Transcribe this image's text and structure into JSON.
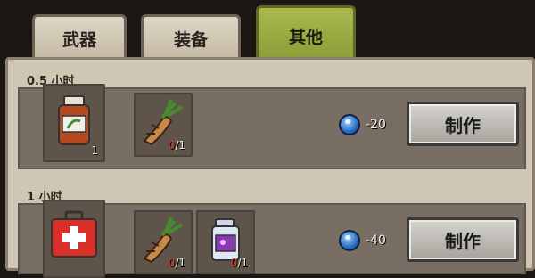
{
  "tabs": [
    {
      "label": "武器",
      "active": false
    },
    {
      "label": "装备",
      "active": false
    },
    {
      "label": "其他",
      "active": true
    }
  ],
  "recipes": [
    {
      "time": "0.5 小时",
      "result": {
        "icon": "medicine-bottle-icon",
        "count": "1"
      },
      "ingredients": [
        {
          "icon": "ginseng-root-icon",
          "have": "0",
          "need": "/1"
        }
      ],
      "cost": "-20",
      "cost_icon": "blue-gem-icon",
      "button": "制作"
    },
    {
      "time": "1 小时",
      "result": {
        "icon": "first-aid-kit-icon",
        "count": ""
      },
      "ingredients": [
        {
          "icon": "ginseng-root-icon",
          "have": "0",
          "need": "/1"
        },
        {
          "icon": "pill-bottle-icon",
          "have": "0",
          "need": "/1"
        }
      ],
      "cost": "-40",
      "cost_icon": "blue-gem-icon",
      "button": "制作"
    }
  ],
  "colors": {
    "active_tab": "#9aab3f",
    "have_count": "#e23a2a"
  }
}
